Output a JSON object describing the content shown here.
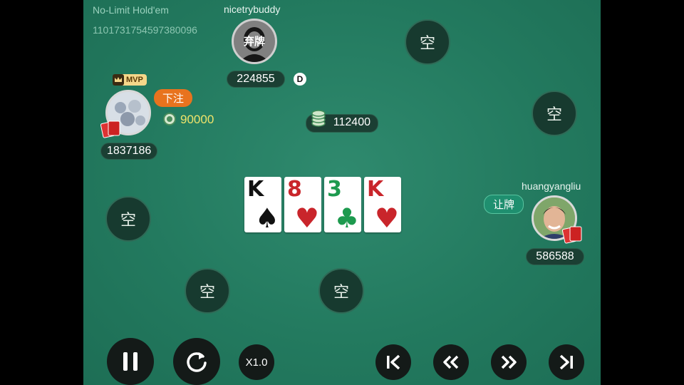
{
  "game": {
    "type": "No-Limit Hold'em",
    "id": "1101731754597380096"
  },
  "players": {
    "top": {
      "name": "nicetrybuddy",
      "stack": "224855",
      "status": "弃牌",
      "dealer": "D"
    },
    "left": {
      "badge": "MVP",
      "action": "下注",
      "bet": "90000",
      "stack": "1837186"
    },
    "right": {
      "name": "huangyangliu",
      "action": "让牌",
      "stack": "586588"
    }
  },
  "pot": "112400",
  "empty_seat_label": "空",
  "board": [
    {
      "rank": "K",
      "suit": "♠",
      "color": "#111111"
    },
    {
      "rank": "8",
      "suit": "♥",
      "color": "#c9252b"
    },
    {
      "rank": "3",
      "suit": "♣",
      "color": "#1d9a4e"
    },
    {
      "rank": "K",
      "suit": "♥",
      "color": "#c9252b"
    }
  ],
  "controls": {
    "speed": "X1.0"
  },
  "colors": {
    "felt": "#237a5f",
    "bet_tag": "#e8731e",
    "check_tag": "#1f8f6f",
    "bet_text": "#f0e46a"
  },
  "icons": [
    "pause-icon",
    "replay-icon",
    "skip-to-start-icon",
    "rewind-icon",
    "fast-forward-icon",
    "skip-to-end-icon",
    "chip-icon",
    "crown-icon",
    "cards-icon"
  ]
}
